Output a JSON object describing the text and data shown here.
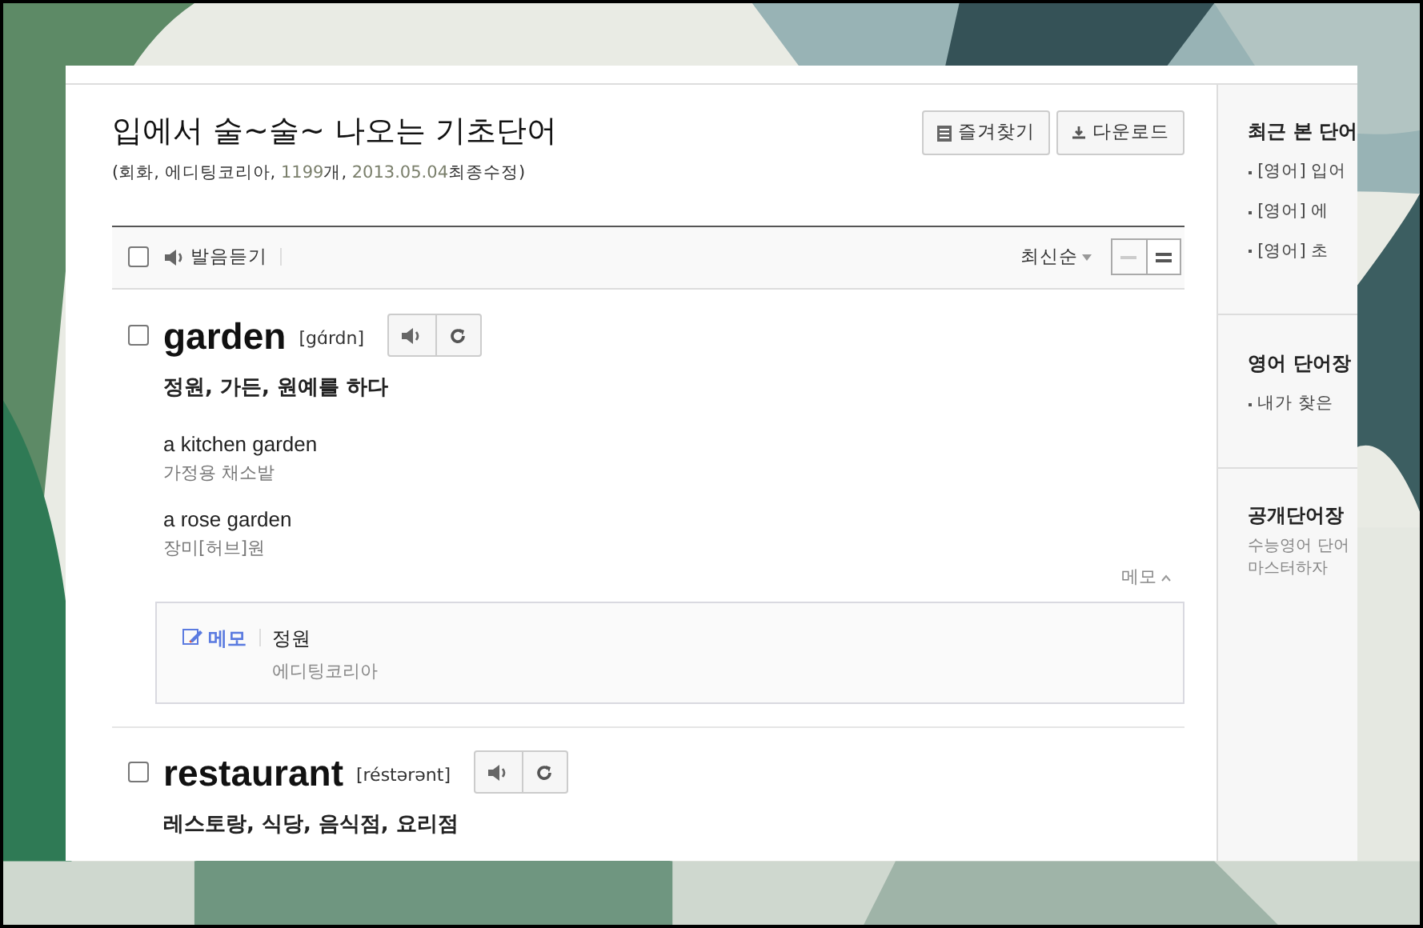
{
  "header": {
    "title": "입에서 술~술~ 나오는 기초단어",
    "meta": [
      {
        "text": "(회화, 에디팅코리아, ",
        "highlight": false
      },
      {
        "text": "1199",
        "highlight": true
      },
      {
        "text": "개, ",
        "highlight": false
      },
      {
        "text": "2013.05.04",
        "highlight": true
      },
      {
        "text": "최종수정)",
        "highlight": false
      }
    ],
    "buttons": [
      {
        "label": "즐겨찾기",
        "kind": "bookmark"
      },
      {
        "label": "다운로드",
        "kind": "download"
      }
    ]
  },
  "toolbar": {
    "checked": false,
    "listen_label": "발음듣기",
    "sort_label": "최신순",
    "view_modes": [
      {
        "kind": "simple",
        "selected": false
      },
      {
        "kind": "detail",
        "selected": true
      }
    ]
  },
  "entries": [
    {
      "word": "garden",
      "pronunciation": "[gɑ́rdn]",
      "checked": false,
      "meaning": "정원, 가든, 원예를 하다",
      "examples": [
        {
          "en": "a kitchen garden",
          "ko": "가정용 채소밭"
        },
        {
          "en": "a rose garden",
          "ko": "장미[허브]원"
        }
      ],
      "memo_toggle": "메모",
      "memo": {
        "label": "메모",
        "text": "정원",
        "author": "에디팅코리아"
      }
    },
    {
      "word": "restaurant",
      "pronunciation": "[réstərənt]",
      "checked": false,
      "meaning": "레스토랑, 식당, 음식점, 요리점"
    }
  ],
  "sidebar": [
    {
      "title": "최근 본 단어",
      "items": [
        "[영어] 입어",
        "[영어] 에",
        "[영어] 초"
      ]
    },
    {
      "title": "영어 단어장",
      "items": [
        "내가 찾은"
      ]
    },
    {
      "title": "공개단어장",
      "lines": [
        "수능영어 단어",
        "마스터하자"
      ]
    }
  ]
}
